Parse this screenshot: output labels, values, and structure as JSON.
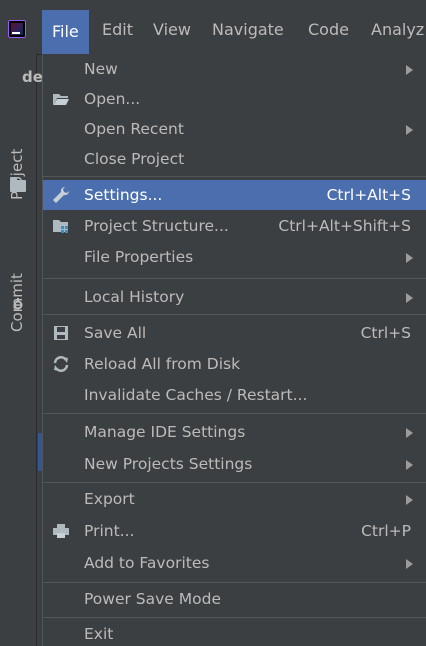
{
  "menubar": {
    "app_icon": "intellij-logo-icon",
    "menus": [
      {
        "label": "File",
        "mnemonic": "F"
      },
      {
        "label": "Edit",
        "mnemonic": "E"
      },
      {
        "label": "View",
        "mnemonic": "V"
      },
      {
        "label": "Navigate",
        "mnemonic": "N"
      },
      {
        "label": "Code",
        "mnemonic": "C"
      },
      {
        "label": "Analyz",
        "mnemonic": ""
      }
    ]
  },
  "sidebar": {
    "project_tab": "Project",
    "commit_tab": "Commit",
    "partial_label": "de"
  },
  "file_menu": {
    "items": [
      {
        "label": "New",
        "shortcut": "",
        "submenu": true,
        "icon": ""
      },
      {
        "label": "Open...",
        "shortcut": "",
        "submenu": false,
        "icon": "folder-open-icon"
      },
      {
        "label": "Open Recent",
        "shortcut": "",
        "submenu": true,
        "icon": ""
      },
      {
        "label": "Close Project",
        "shortcut": "",
        "submenu": false,
        "icon": ""
      },
      {
        "label": "Settings...",
        "shortcut": "Ctrl+Alt+S",
        "submenu": false,
        "icon": "wrench-icon"
      },
      {
        "label": "Project Structure...",
        "shortcut": "Ctrl+Alt+Shift+S",
        "submenu": false,
        "icon": "project-structure-icon"
      },
      {
        "label": "File Properties",
        "shortcut": "",
        "submenu": true,
        "icon": ""
      },
      {
        "label": "Local History",
        "shortcut": "",
        "submenu": true,
        "icon": ""
      },
      {
        "label": "Save All",
        "shortcut": "Ctrl+S",
        "submenu": false,
        "icon": "save-icon"
      },
      {
        "label": "Reload All from Disk",
        "shortcut": "",
        "submenu": false,
        "icon": "reload-icon"
      },
      {
        "label": "Invalidate Caches / Restart...",
        "shortcut": "",
        "submenu": false,
        "icon": ""
      },
      {
        "label": "Manage IDE Settings",
        "shortcut": "",
        "submenu": true,
        "icon": ""
      },
      {
        "label": "New Projects Settings",
        "shortcut": "",
        "submenu": true,
        "icon": ""
      },
      {
        "label": "Export",
        "shortcut": "",
        "submenu": true,
        "icon": ""
      },
      {
        "label": "Print...",
        "shortcut": "Ctrl+P",
        "submenu": false,
        "icon": "printer-icon"
      },
      {
        "label": "Add to Favorites",
        "shortcut": "",
        "submenu": true,
        "icon": ""
      },
      {
        "label": "Power Save Mode",
        "shortcut": "",
        "submenu": false,
        "icon": ""
      },
      {
        "label": "Exit",
        "shortcut": "",
        "submenu": false,
        "icon": ""
      }
    ],
    "selected_index": 4
  },
  "colors": {
    "background": "#3c3f41",
    "selection": "#4b6eaf",
    "text": "#bbbbbb",
    "separator": "#515658"
  }
}
